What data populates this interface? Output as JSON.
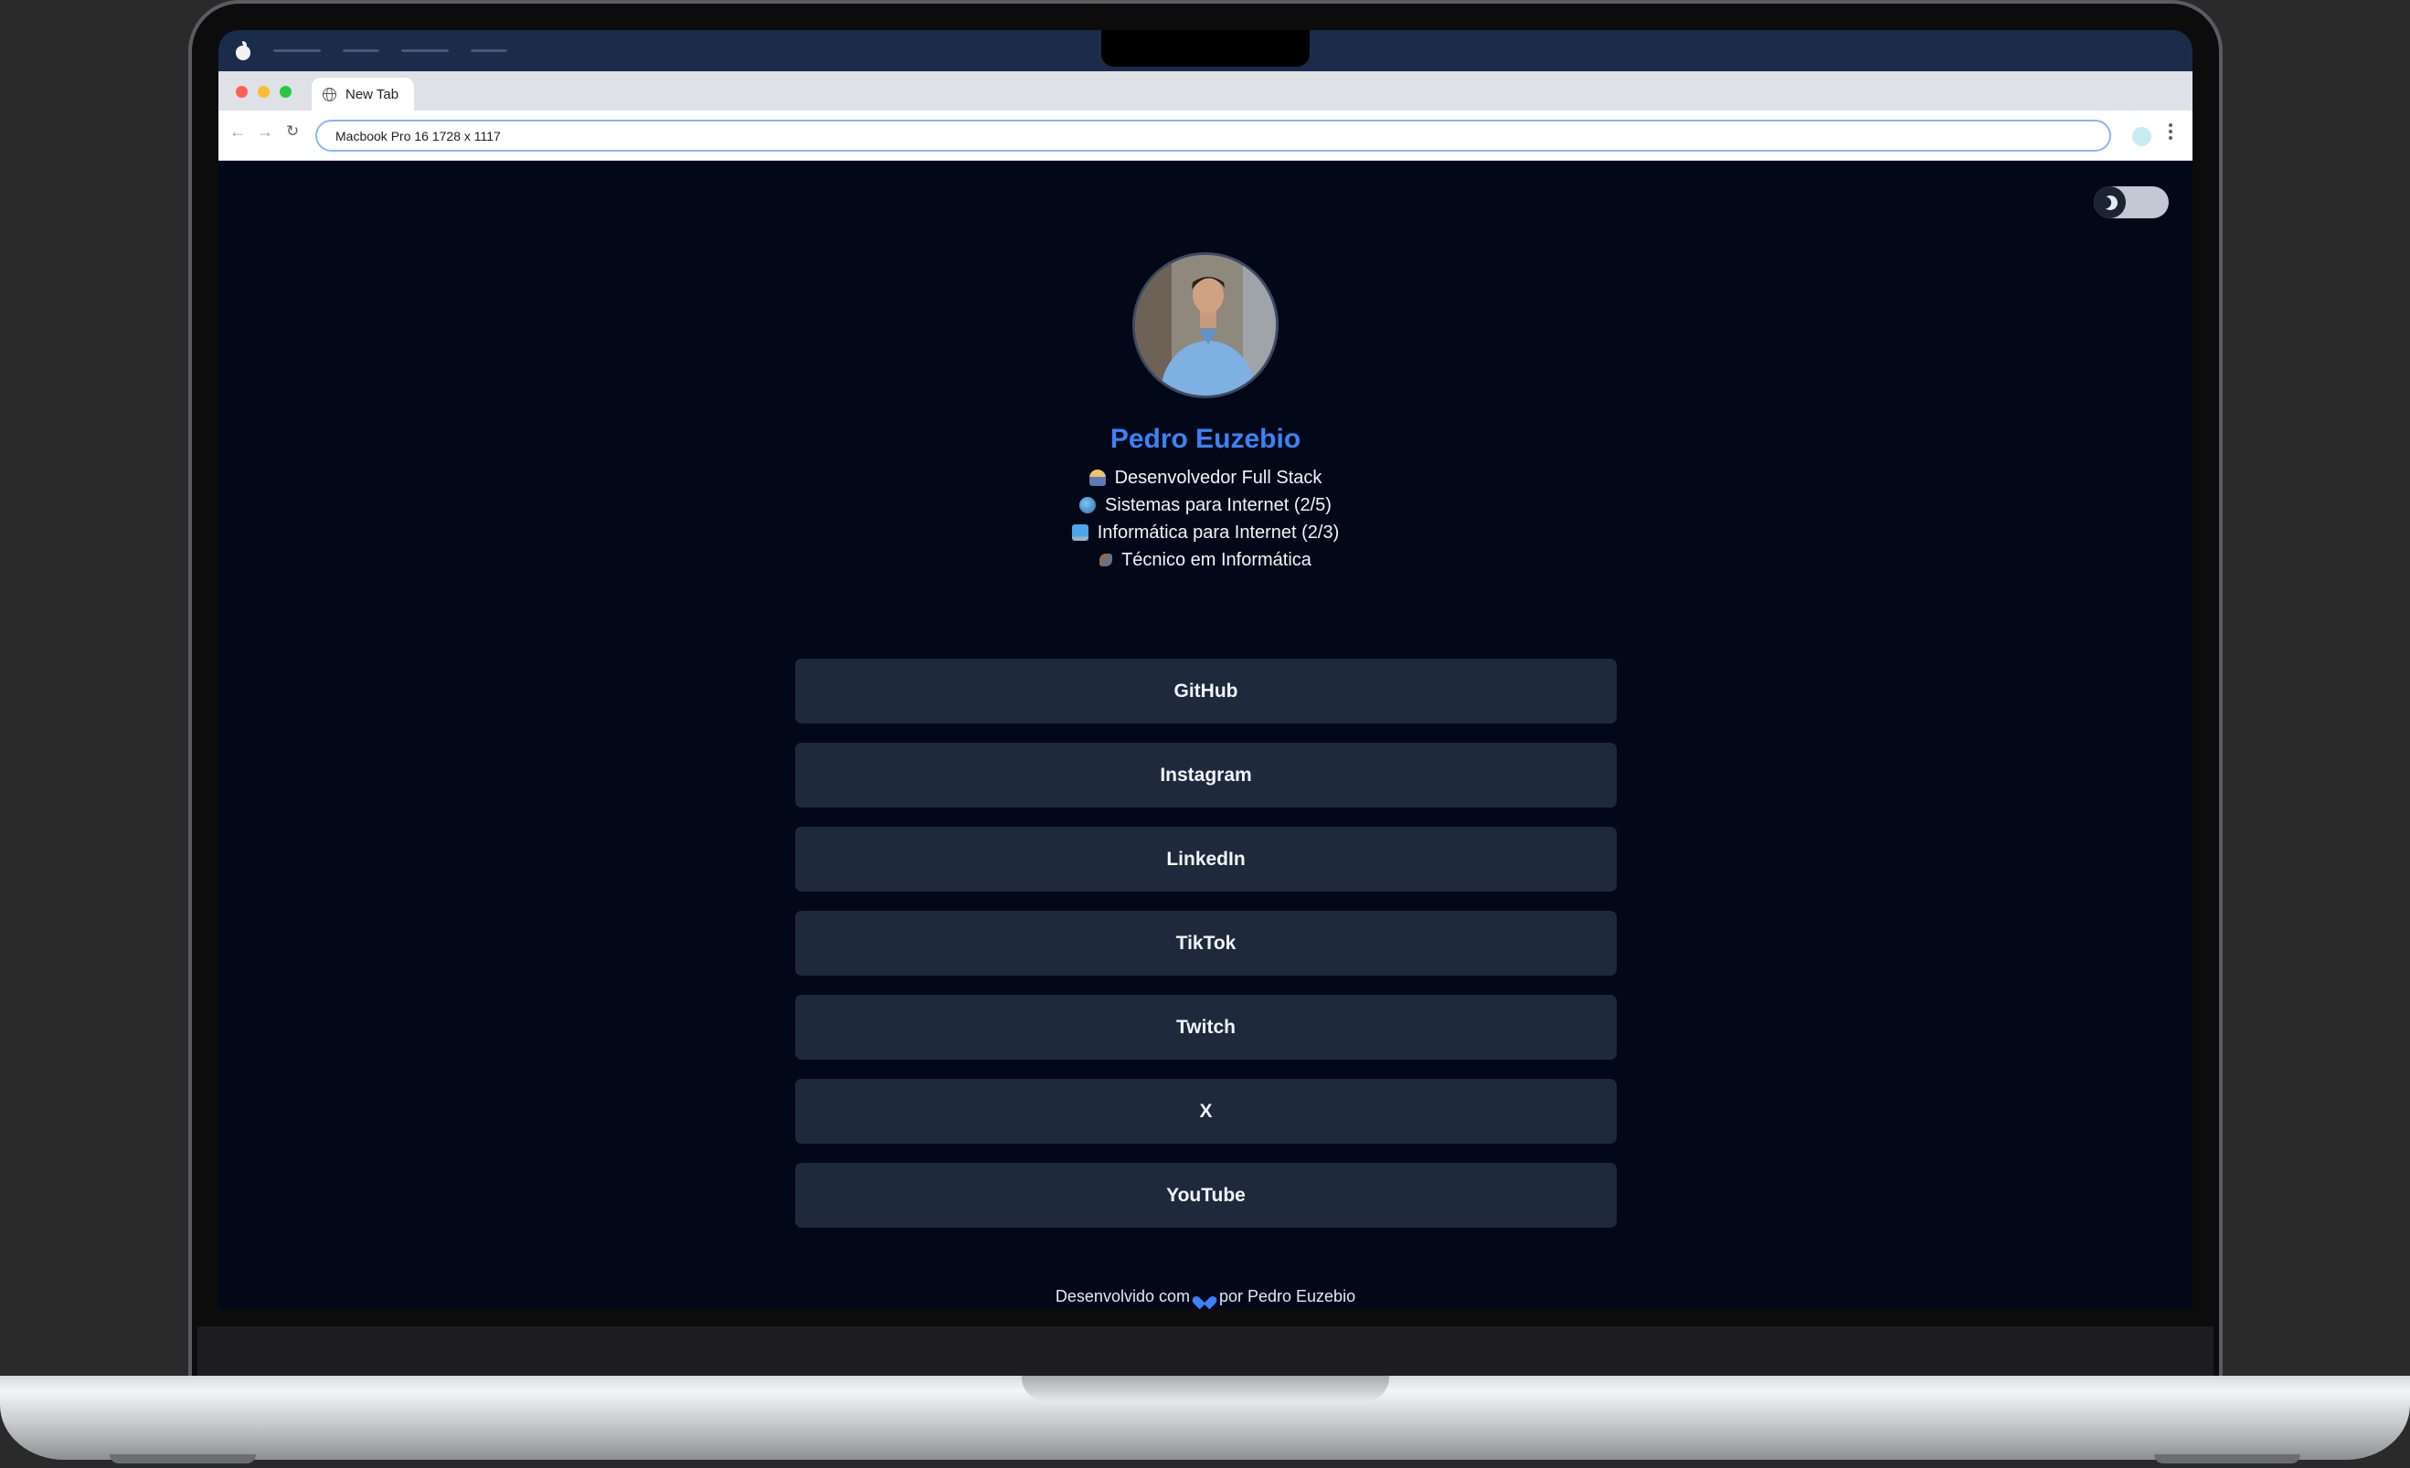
{
  "browser": {
    "tab_title": "New Tab",
    "address": "Macbook Pro 16   1728 x 1117"
  },
  "profile": {
    "name": "Pedro Euzebio",
    "avatar_alt": "profile-photo",
    "bio": [
      {
        "icon": "technologist-emoji",
        "text": "Desenvolvedor Full Stack"
      },
      {
        "icon": "globe-emoji",
        "text": "Sistemas para Internet (2/5)"
      },
      {
        "icon": "laptop-emoji",
        "text": "Informática para Internet (2/3)"
      },
      {
        "icon": "tool-emoji",
        "text": "Técnico em Informática"
      }
    ]
  },
  "links": [
    "GitHub",
    "Instagram",
    "LinkedIn",
    "TikTok",
    "Twitch",
    "X",
    "YouTube"
  ],
  "footer": {
    "prefix": "Desenvolvido com",
    "suffix": "por Pedro Euzebio"
  },
  "theme": {
    "mode": "dark",
    "accent": "#3b82f6",
    "background": "#020817",
    "button_bg": "#1e293b"
  }
}
